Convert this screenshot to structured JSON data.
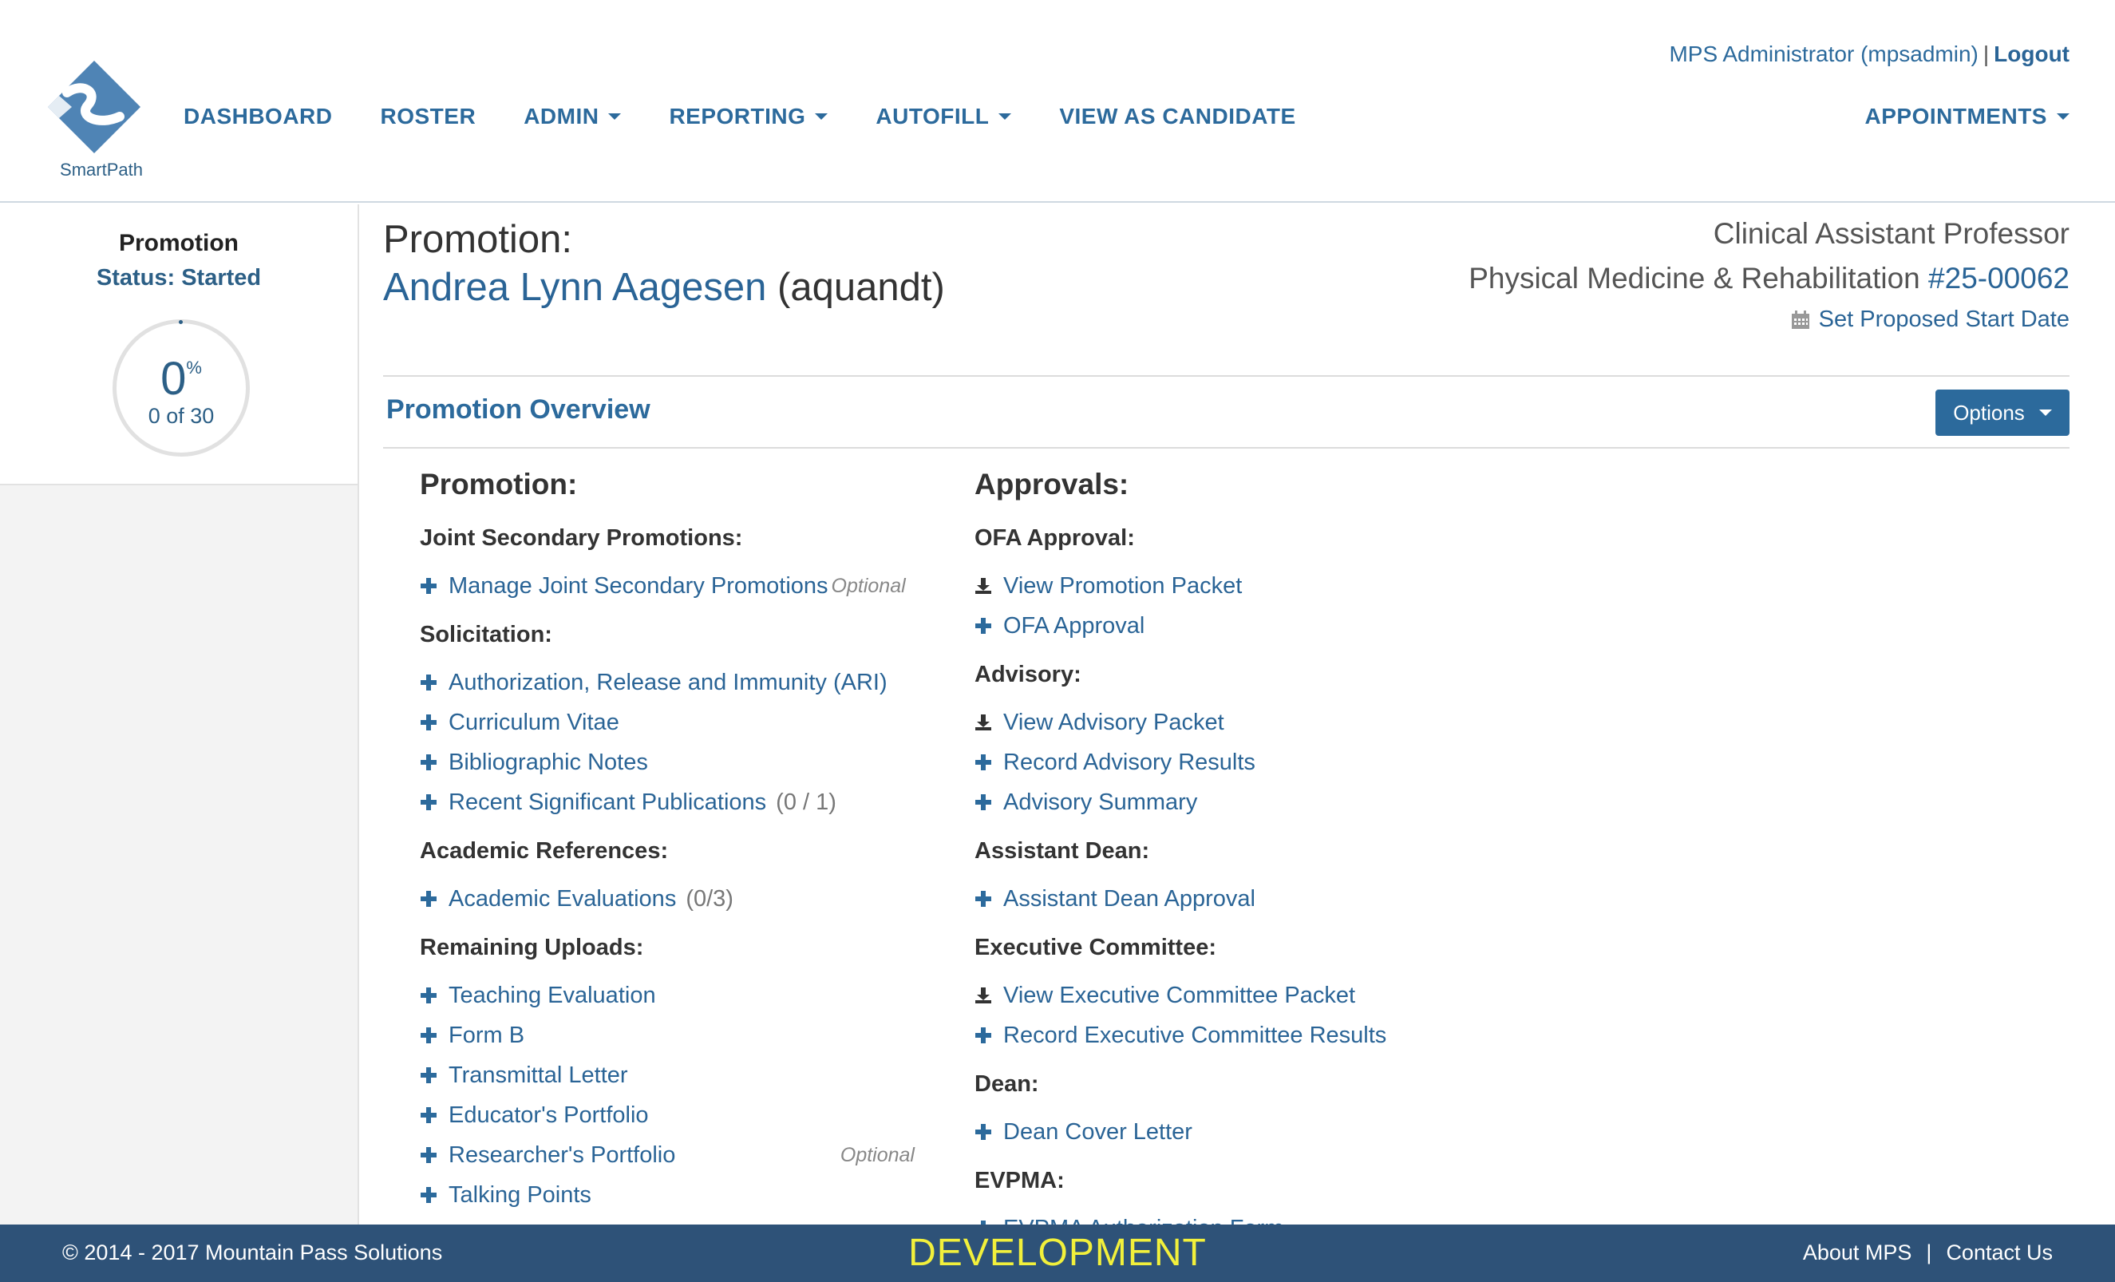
{
  "brand": {
    "name": "SmartPath",
    "accent": "#2c6a9c",
    "footer_bg": "#2e5278",
    "env_color": "#f2f03b"
  },
  "nav": {
    "items": [
      {
        "label": "DASHBOARD",
        "dropdown": false
      },
      {
        "label": "ROSTER",
        "dropdown": false
      },
      {
        "label": "ADMIN",
        "dropdown": true
      },
      {
        "label": "REPORTING",
        "dropdown": true
      },
      {
        "label": "AUTOFILL",
        "dropdown": true
      },
      {
        "label": "VIEW AS CANDIDATE",
        "dropdown": false
      }
    ],
    "appointments_label": "APPOINTMENTS"
  },
  "user": {
    "display": "MPS Administrator (mpsadmin)",
    "separator": "|",
    "logout_label": "Logout"
  },
  "sidebar": {
    "title": "Promotion",
    "status": "Status: Started",
    "progress": {
      "percent": 0,
      "percent_label": "0",
      "percent_sign": "%",
      "count_label": "0 of 30"
    }
  },
  "main": {
    "title_label": "Promotion:",
    "candidate_name": "Andrea Lynn Aagesen",
    "candidate_uid": "(aquandt)",
    "rank": "Clinical Assistant Professor",
    "department": "Physical Medicine & Rehabilitation",
    "department_number": "#25-00062",
    "start_date_link": "Set Proposed Start Date",
    "overview_title": "Promotion Overview",
    "options_label": "Options"
  },
  "promotion_column": {
    "heading": "Promotion:",
    "sections": [
      {
        "title": "Joint Secondary Promotions:",
        "items": [
          {
            "label": "Manage Joint Secondary Promotions",
            "optional_inline": "Optional"
          }
        ]
      },
      {
        "title": "Solicitation:",
        "items": [
          {
            "label": "Authorization, Release and Immunity (ARI)"
          },
          {
            "label": "Curriculum Vitae"
          },
          {
            "label": "Bibliographic Notes"
          },
          {
            "label": "Recent Significant Publications",
            "count": "(0 / 1)"
          }
        ]
      },
      {
        "title": "Academic References:",
        "items": [
          {
            "label": "Academic Evaluations",
            "count": "(0/3)"
          }
        ]
      },
      {
        "title": "Remaining Uploads:",
        "items": [
          {
            "label": "Teaching Evaluation"
          },
          {
            "label": "Form B"
          },
          {
            "label": "Transmittal Letter"
          },
          {
            "label": "Educator's Portfolio"
          },
          {
            "label": "Researcher's Portfolio",
            "optional": "Optional"
          },
          {
            "label": "Talking Points"
          }
        ]
      }
    ]
  },
  "approvals_column": {
    "heading": "Approvals:",
    "sections": [
      {
        "title": "OFA Approval:",
        "items": [
          {
            "label": "View Promotion Packet",
            "icon": "download-icon"
          },
          {
            "label": "OFA Approval",
            "icon": "plus-icon"
          }
        ]
      },
      {
        "title": "Advisory:",
        "items": [
          {
            "label": "View Advisory Packet",
            "icon": "download-icon"
          },
          {
            "label": "Record Advisory Results",
            "icon": "plus-icon"
          },
          {
            "label": "Advisory Summary",
            "icon": "plus-icon"
          }
        ]
      },
      {
        "title": "Assistant Dean:",
        "items": [
          {
            "label": "Assistant Dean Approval",
            "icon": "plus-icon"
          }
        ]
      },
      {
        "title": "Executive Committee:",
        "items": [
          {
            "label": "View Executive Committee Packet",
            "icon": "download-icon"
          },
          {
            "label": "Record Executive Committee Results",
            "icon": "plus-icon"
          }
        ]
      },
      {
        "title": "Dean:",
        "items": [
          {
            "label": "Dean Cover Letter",
            "icon": "plus-icon"
          }
        ]
      },
      {
        "title": "EVPMA:",
        "items": [
          {
            "label": "EVPMA Authorization Form",
            "icon": "plus-icon"
          }
        ]
      }
    ]
  },
  "footer": {
    "copyright": "© 2014 - 2017 Mountain Pass Solutions",
    "environment": "DEVELOPMENT",
    "about_label": "About MPS",
    "separator": "|",
    "contact_label": "Contact Us"
  }
}
